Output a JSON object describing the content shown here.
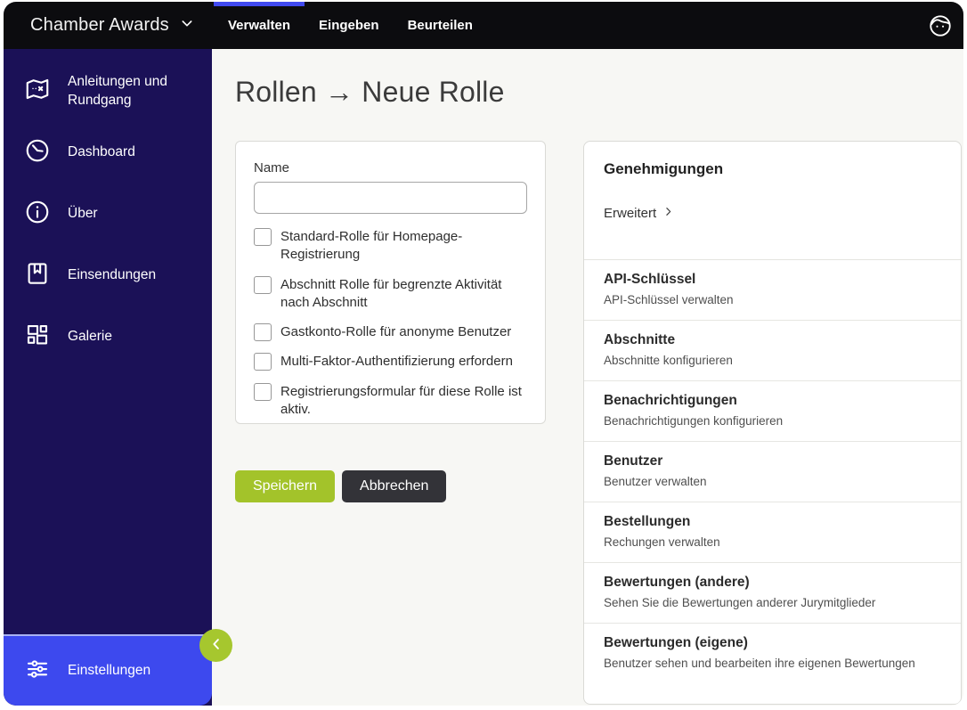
{
  "topbar": {
    "brand": "Chamber Awards",
    "tabs": [
      {
        "label": "Verwalten",
        "active": true
      },
      {
        "label": "Eingeben",
        "active": false
      },
      {
        "label": "Beurteilen",
        "active": false
      }
    ]
  },
  "sidebar": {
    "items": [
      {
        "label": "Anleitungen und Rundgang",
        "icon": "map-icon"
      },
      {
        "label": "Dashboard",
        "icon": "clock-icon"
      },
      {
        "label": "Über",
        "icon": "info-icon"
      },
      {
        "label": "Einsendungen",
        "icon": "bookmark-icon"
      },
      {
        "label": "Galerie",
        "icon": "grid-icon"
      }
    ],
    "settings": {
      "label": "Einstellungen",
      "icon": "sliders-icon"
    }
  },
  "page": {
    "title": "Rollen → Neue Rolle"
  },
  "form": {
    "name_label": "Name",
    "name_value": "",
    "checkboxes": [
      "Standard-Rolle für Homepage-Registrierung",
      "Abschnitt Rolle für begrenzte Aktivität nach Abschnitt",
      "Gastkonto-Rolle für anonyme Benutzer",
      "Multi-Faktor-Authentifizierung erfordern",
      "Registrierungsformular für diese Rolle ist aktiv."
    ],
    "save_label": "Speichern",
    "cancel_label": "Abbrechen"
  },
  "permissions": {
    "title": "Genehmigungen",
    "advanced_label": "Erweitert",
    "items": [
      {
        "title": "API-Schlüssel",
        "subtitle": "API-Schlüssel verwalten"
      },
      {
        "title": "Abschnitte",
        "subtitle": "Abschnitte konfigurieren"
      },
      {
        "title": "Benachrichtigungen",
        "subtitle": "Benachrichtigungen konfigurieren"
      },
      {
        "title": "Benutzer",
        "subtitle": "Benutzer verwalten"
      },
      {
        "title": "Bestellungen",
        "subtitle": "Rechungen verwalten"
      },
      {
        "title": "Bewertungen (andere)",
        "subtitle": "Sehen Sie die Bewertungen anderer Jurymitglieder"
      },
      {
        "title": "Bewertungen (eigene)",
        "subtitle": "Benutzer sehen und bearbeiten ihre eigenen Bewertungen"
      }
    ]
  },
  "colors": {
    "topbar_bg": "#0c0c0f",
    "sidebar_bg": "#1b1157",
    "accent_blue": "#414af0",
    "settings_blue": "#3d49ee",
    "lime_green": "#a6c72e",
    "save_green": "#a3c32a",
    "cancel_dark": "#333338",
    "content_bg": "#f7f7f4"
  }
}
